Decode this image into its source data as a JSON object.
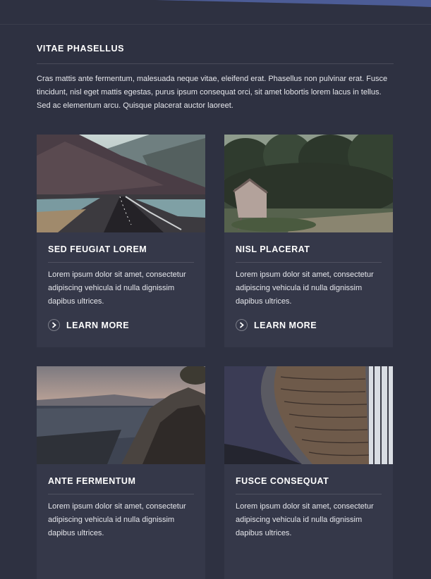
{
  "colors": {
    "background": "#2e3141",
    "card": "#353849",
    "accent": "#4c5c96"
  },
  "section": {
    "title": "VITAE PHASELLUS",
    "intro": "Cras mattis ante fermentum, malesuada neque vitae, eleifend erat. Phasellus non pulvinar erat. Fusce tincidunt, nisl eget mattis egestas, purus ipsum consequat orci, sit amet lobortis lorem lacus in tellus. Sed ac elementum arcu. Quisque placerat auctor laoreet."
  },
  "cards": [
    {
      "image": "mountain-road-photo",
      "title": "SED FEUGIAT LOREM",
      "text": "Lorem ipsum dolor sit amet, consectetur adipiscing vehicula id nulla dignissim dapibus ultrices.",
      "link": "LEARN MORE",
      "link_icon": "chevron-right-icon"
    },
    {
      "image": "forest-cabin-photo",
      "title": "NISL PLACERAT",
      "text": "Lorem ipsum dolor sit amet, consectetur adipiscing vehicula id nulla dignissim dapibus ultrices.",
      "link": "LEARN MORE",
      "link_icon": "chevron-right-icon"
    },
    {
      "image": "rocky-valley-photo",
      "title": "ANTE FERMENTUM",
      "text": "Lorem ipsum dolor sit amet, consectetur adipiscing vehicula id nulla dignissim dapibus ultrices."
    },
    {
      "image": "library-shelves-photo",
      "title": "FUSCE CONSEQUAT",
      "text": "Lorem ipsum dolor sit amet, consectetur adipiscing vehicula id nulla dignissim dapibus ultrices."
    }
  ]
}
